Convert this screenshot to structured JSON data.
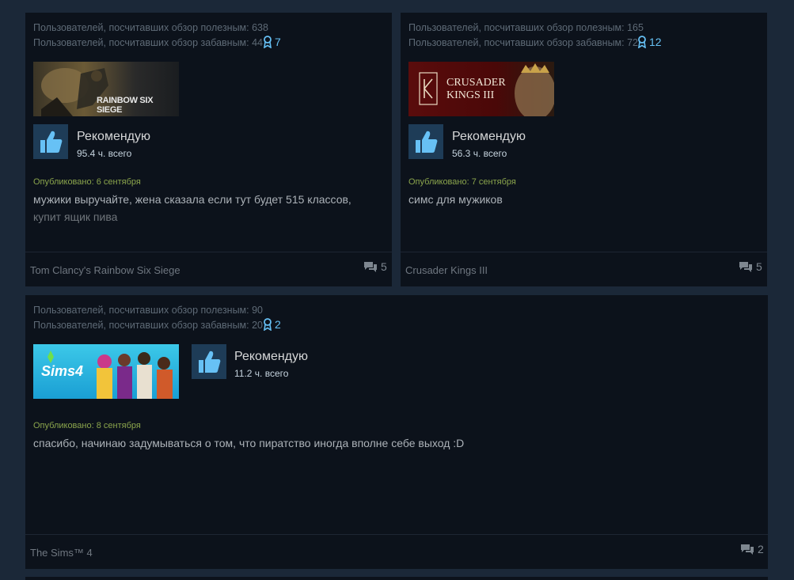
{
  "reviews": [
    {
      "helpful": "Пользователей, посчитавших обзор полезным: 638",
      "funny": "Пользователей, посчитавших обзор забавным: 44",
      "awards": "7",
      "capsule_text": "RAINBOW SIX SIEGE",
      "recommend": "Рекомендую",
      "hours": "95.4 ч. всего",
      "posted": "Опубликовано: 6 сентября",
      "text_line1": "мужики выручайте, жена сказала если тут будет 515 классов,",
      "text_line2": "купит ящик пива",
      "game": "Tom Clancy's Rainbow Six Siege",
      "comments": "5"
    },
    {
      "helpful": "Пользователей, посчитавших обзор полезным: 165",
      "funny": "Пользователей, посчитавших обзор забавным: 72",
      "awards": "12",
      "capsule_text_1": "CRUSADER",
      "capsule_text_2": "KINGS III",
      "recommend": "Рекомендую",
      "hours": "56.3 ч. всего",
      "posted": "Опубликовано: 7 сентября",
      "text_line1": "симс для мужиков",
      "game": "Crusader Kings III",
      "comments": "5"
    },
    {
      "helpful": "Пользователей, посчитавших обзор полезным: 90",
      "funny": "Пользователей, посчитавших обзор забавным: 20",
      "awards": "2",
      "capsule_text": "Sims4",
      "recommend": "Рекомендую",
      "hours": "11.2 ч. всего",
      "posted": "Опубликовано: 8 сентября",
      "text_line1": "спасибо, начинаю задумываться о том, что пиратство иногда вполне себе выход :D",
      "game": "The Sims™ 4",
      "comments": "2"
    }
  ],
  "colors": {
    "page_bg": "#1b2838",
    "card_bg": "#0c121b",
    "award_blue": "#66c0f4",
    "posted_green": "#8ba54c",
    "thumb_bg": "#1e3c57"
  },
  "icons": {
    "award": "award-ribbon-icon",
    "thumbs_up": "thumbs-up-icon",
    "comments": "comment-bubbles-icon"
  }
}
